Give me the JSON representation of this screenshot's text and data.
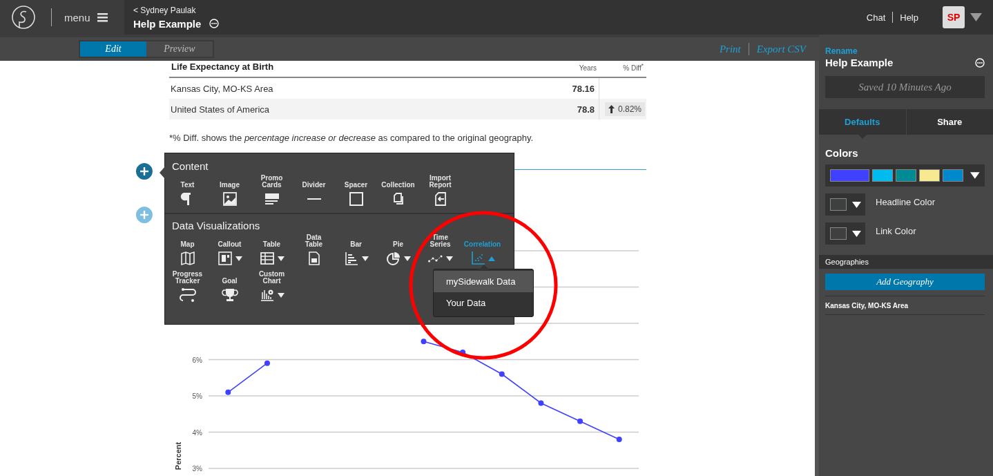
{
  "header": {
    "menu_label": "menu",
    "breadcrumb": "< Sydney Paulak",
    "title": "Help Example",
    "links": [
      "Chat",
      "Help"
    ],
    "avatar": "SP"
  },
  "toolbar": {
    "modes": [
      {
        "label": "Edit",
        "selected": true
      },
      {
        "label": "Preview",
        "selected": false
      }
    ],
    "actions": [
      "Print",
      "Export CSV"
    ]
  },
  "table": {
    "title": "Life Expectancy at Birth",
    "columns": [
      "Years",
      "% Diff$^{*}$"
    ],
    "rows": [
      {
        "name": "Kansas City, MO-KS Area",
        "value": "78.16"
      },
      {
        "name": "United States of America",
        "value": "78.8",
        "diff": "0.82%",
        "increase": true
      }
    ]
  },
  "note": "*% Diff. shows the *percentage increase or decrease* as compared to the original geography.",
  "add_buttons": [
    {
      "active": true
    },
    {
      "active": false
    }
  ],
  "insert_menu": {
    "sections": [
      {
        "title": "Content",
        "items": [
          {
            "label": "Text",
            "kind": "text",
            "dropdown": false,
            "expanded": false
          },
          {
            "label": "Image",
            "kind": "image",
            "dropdown": false,
            "expanded": false
          },
          {
            "label": "Promo Cards",
            "kind": "cards",
            "dropdown": false,
            "expanded": false
          },
          {
            "label": "Divider",
            "kind": "divider",
            "dropdown": false,
            "expanded": false
          },
          {
            "label": "Spacer",
            "kind": "spacer",
            "dropdown": false,
            "expanded": false
          },
          {
            "label": "Collection",
            "kind": "collection",
            "dropdown": false,
            "expanded": false
          },
          {
            "label": "Import Report",
            "kind": "import",
            "dropdown": false,
            "expanded": false
          }
        ]
      },
      {
        "title": "Data Visualizations",
        "items": [
          {
            "label": "Map",
            "kind": "map",
            "dropdown": false,
            "expanded": false
          },
          {
            "label": "Callout",
            "kind": "callout",
            "dropdown": true,
            "expanded": false
          },
          {
            "label": "Table",
            "kind": "table",
            "dropdown": true,
            "expanded": false
          },
          {
            "label": "Data Table",
            "kind": "csv",
            "dropdown": false,
            "expanded": false
          },
          {
            "label": "Bar",
            "kind": "bar",
            "dropdown": true,
            "expanded": false
          },
          {
            "label": "Pie",
            "kind": "pie",
            "dropdown": true,
            "expanded": false
          },
          {
            "label": "Time Series",
            "kind": "series",
            "dropdown": true,
            "expanded": false
          },
          {
            "label": "Correlation",
            "kind": "scatter",
            "dropdown": true,
            "expanded": true
          },
          {
            "label": "Progress Tracker",
            "kind": "progress",
            "dropdown": false,
            "expanded": false
          },
          {
            "label": "Goal",
            "kind": "trophy",
            "dropdown": false,
            "expanded": false
          },
          {
            "label": "Custom Chart",
            "kind": "custom",
            "dropdown": true,
            "expanded": false
          }
        ]
      }
    ]
  },
  "dropdown_menu": {
    "items": [
      {
        "label": "mySidewalk Data",
        "selected": true
      },
      {
        "label": "Your Data",
        "selected": false
      }
    ]
  },
  "chart_data": {
    "type": "line",
    "grid": true,
    "categories": [
      null,
      null,
      null,
      null,
      null,
      null,
      null,
      null,
      null,
      null,
      null
    ],
    "ylabel": "Percent",
    "ylim": [
      3,
      9
    ],
    "yticks": [
      {
        "value": 3,
        "label": "3%"
      },
      {
        "value": 4,
        "label": "4%"
      },
      {
        "value": 5,
        "label": "5%"
      },
      {
        "value": 6,
        "label": "6%"
      }
    ],
    "series": [
      {
        "color": "#4040ff",
        "marker": "circle",
        "values": [
          5.1,
          5.9,
          null,
          null,
          null,
          6.5,
          6.2,
          5.6,
          4.8,
          4.3,
          3.8
        ]
      }
    ]
  },
  "sidebar": {
    "rename_link": "Rename",
    "title": "Help Example",
    "saved_status": "Saved 10 Minutes Ago",
    "tabs": [
      {
        "label": "Defaults",
        "selected": true
      },
      {
        "label": "Share",
        "selected": false
      }
    ],
    "colors_heading": "Colors",
    "palette": [
      {
        "color": "#4040ff"
      },
      {
        "color": "#00bbee"
      },
      {
        "color": "#008a94"
      },
      {
        "color": "#f6e98f"
      },
      {
        "color": "#0088cc"
      }
    ],
    "color_settings": [
      {
        "label": "Headline Color",
        "color": "#3d403f"
      },
      {
        "label": "Link Color",
        "color": "#3d403f"
      }
    ],
    "geographies_heading": "Geographies",
    "add_geography_button": "Add Geography",
    "geographies": [
      "Kansas City, MO-KS Area"
    ]
  }
}
